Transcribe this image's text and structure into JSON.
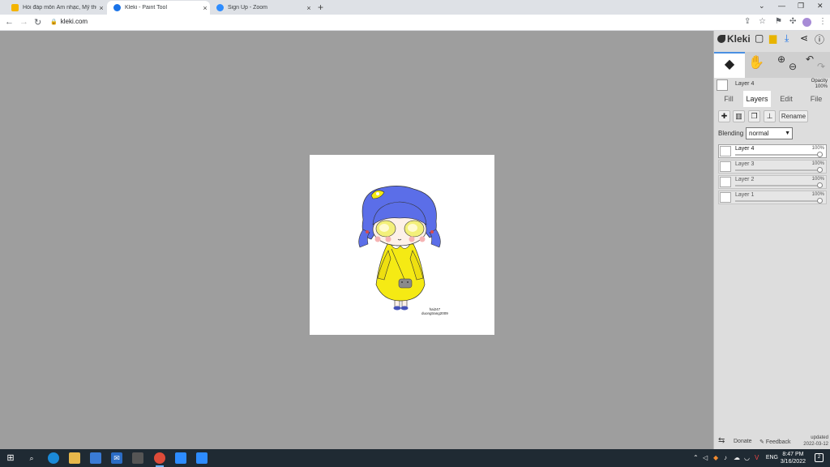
{
  "browser": {
    "tabs": [
      {
        "title": "Hỏi đáp môn Âm nhạc, Mỹ thuật",
        "favicon_color": "#f4b400",
        "active": false
      },
      {
        "title": "Kleki - Paint Tool",
        "favicon_color": "#1a73e8",
        "active": true
      },
      {
        "title": "Sign Up - Zoom",
        "favicon_color": "#2d8cff",
        "active": false
      }
    ],
    "url": "kleki.com"
  },
  "kleki": {
    "logo": "Kleki",
    "current_layer": "Layer 4",
    "opacity_label": "Opacity",
    "opacity_value": "100%",
    "tabs": [
      "Fill",
      "Layers",
      "Edit",
      "File"
    ],
    "selected_tab": "Layers",
    "rename_label": "Rename",
    "blending_label": "Blending",
    "blending_value": "normal",
    "layers": [
      {
        "name": "Layer 4",
        "opacity": "100%",
        "selected": true
      },
      {
        "name": "Layer 3",
        "opacity": "100%",
        "selected": false
      },
      {
        "name": "Layer 2",
        "opacity": "100%",
        "selected": false
      },
      {
        "name": "Layer 1",
        "opacity": "100%",
        "selected": false
      }
    ],
    "donate": "Donate",
    "feedback": "Feedback",
    "updated_label": "updated",
    "updated_date": "2022-03-12"
  },
  "artwork": {
    "signature_line1": "hai247",
    "signature_line2": "duongtrang2009",
    "colors": {
      "hair": "#5b6ee8",
      "dress": "#f5ea14",
      "skin": "#fdf1e8",
      "eyes": "#f3f07a"
    }
  },
  "taskbar": {
    "lang": "ENG",
    "time": "8:47 PM",
    "date": "3/16/2022",
    "notifications": "2"
  }
}
